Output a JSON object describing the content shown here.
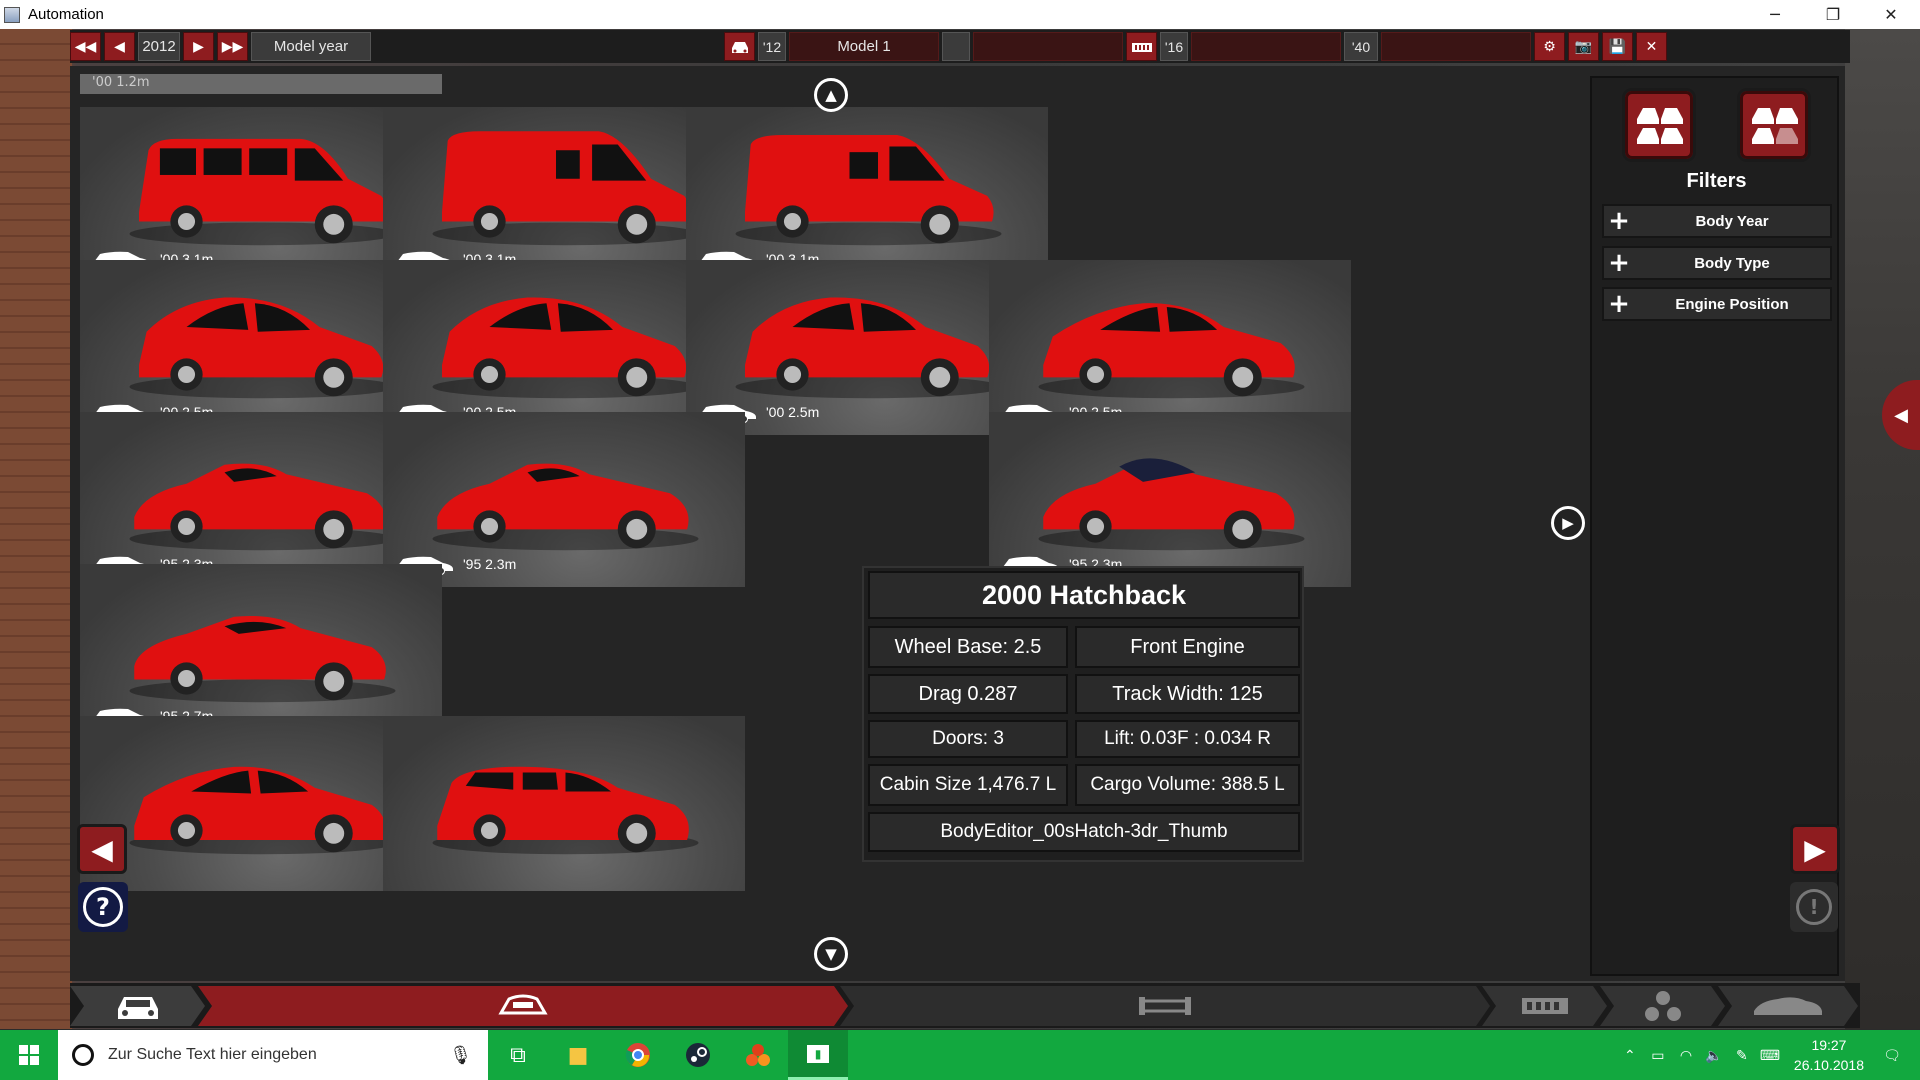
{
  "window": {
    "title": "Automation",
    "minimize": "─",
    "restore": "❐",
    "close": "✕"
  },
  "toolbar": {
    "year": "2012",
    "sort_label": "Model year",
    "model_year_short": "'12",
    "model_name": "Model 1",
    "engine_year": "'16",
    "trim_year": "'40"
  },
  "top_partial_card": {
    "meta": "'00 1.2m"
  },
  "cards": [
    {
      "meta": "'00 3.1m",
      "body": "van-windows"
    },
    {
      "meta": "'00 3.1m",
      "body": "van"
    },
    {
      "meta": "'00 3.1m",
      "body": "van-short"
    },
    {
      "meta": "'00 2.5m",
      "body": "hatchback"
    },
    {
      "meta": "'00 2.5m",
      "body": "hatchback"
    },
    {
      "meta": "'00 2.5m",
      "body": "hatchback"
    },
    {
      "meta": "'00 2.5m",
      "body": "sedan"
    },
    {
      "meta": "'95 2.3m",
      "body": "roadster"
    },
    {
      "meta": "'95 2.3m",
      "body": "roadster"
    },
    {
      "meta": "'95 2.3m",
      "body": "roadster-top"
    },
    {
      "meta": "'95 2.7m",
      "body": "coupe"
    },
    {
      "meta": "",
      "body": "sedan-long"
    },
    {
      "meta": "",
      "body": "wagon"
    }
  ],
  "tooltip": {
    "title": "2000 Hatchback",
    "wheel_base": "Wheel Base: 2.5",
    "engine": "Front Engine",
    "drag": "Drag 0.287",
    "track_width": "Track Width: 125",
    "doors": "Doors: 3",
    "lift": "Lift: 0.03F : 0.034 R",
    "cabin": "Cabin Size 1,476.7 L",
    "cargo": "Cargo Volume: 388.5 L",
    "asset": "BodyEditor_00sHatch-3dr_Thumb"
  },
  "filters": {
    "heading": "Filters",
    "items": [
      {
        "label": "Body Year"
      },
      {
        "label": "Body Type"
      },
      {
        "label": "Engine Position"
      }
    ]
  },
  "help": {
    "label": "?"
  },
  "warning": {
    "label": "!"
  },
  "taskbar": {
    "search_placeholder": "Zur Suche Text hier eingeben",
    "time": "19:27",
    "date": "26.10.2018"
  },
  "colors": {
    "accent": "#8e1c1f",
    "taskbar": "#12a83f",
    "car": "#e01010"
  }
}
